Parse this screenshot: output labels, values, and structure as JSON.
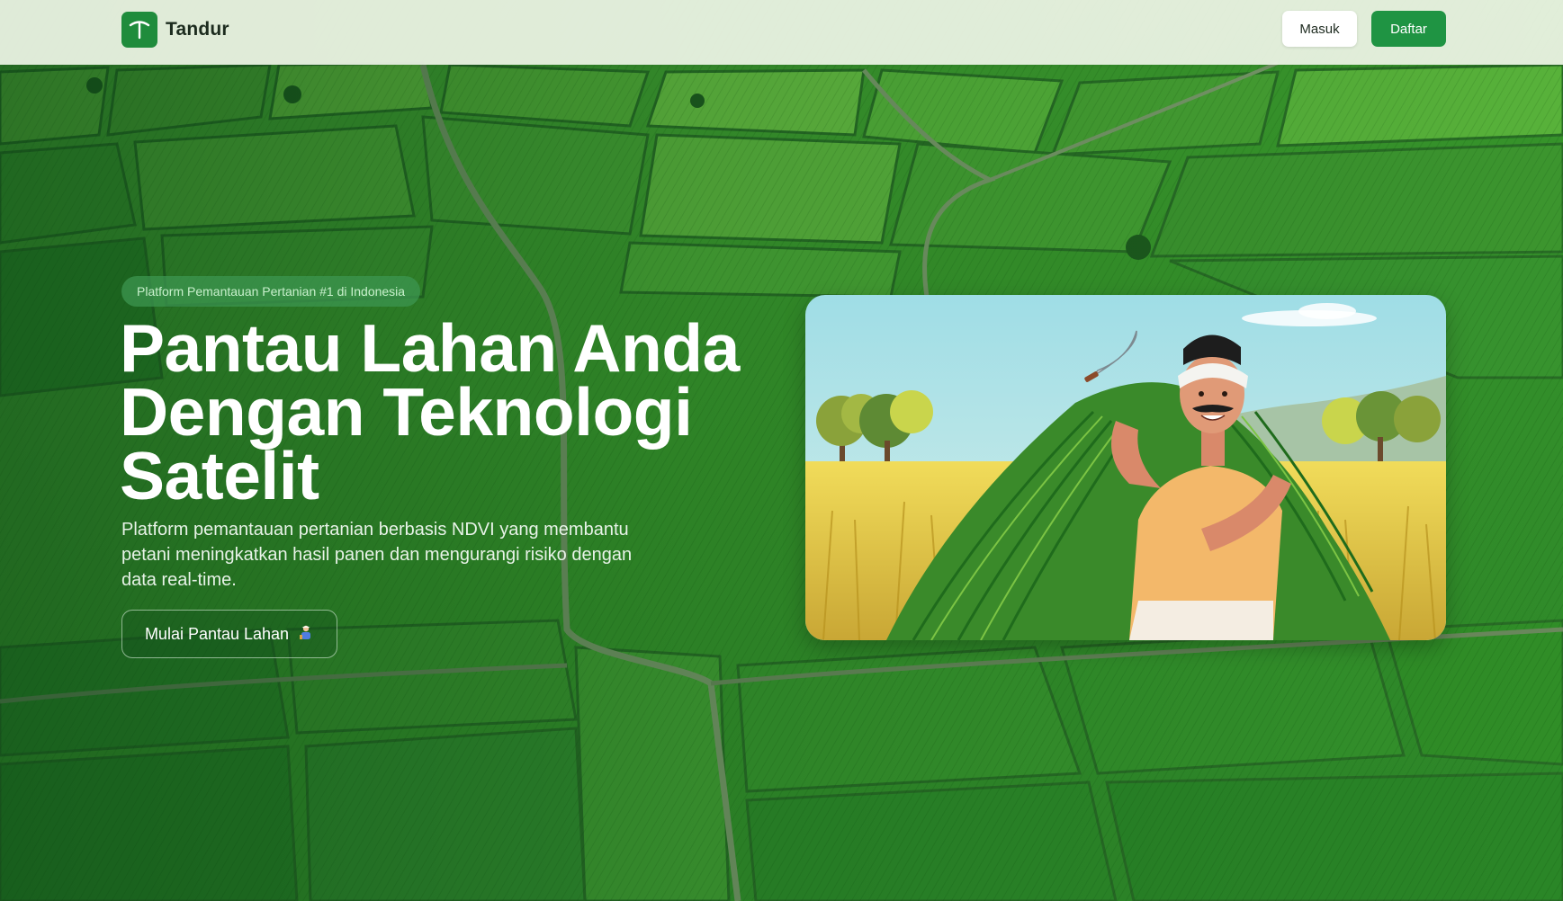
{
  "header": {
    "brand_name": "Tandur",
    "logo_icon": "sprout-icon",
    "login_label": "Masuk",
    "register_label": "Daftar"
  },
  "hero": {
    "badge": "Platform Pemantauan Pertanian #1 di Indonesia",
    "title_lines": [
      "Pantau Lahan Anda",
      "Dengan Teknologi",
      "Satelit"
    ],
    "description": "Platform pemantauan pertanian berbasis NDVI yang membantu petani meningkatkan hasil panen dan mengurangi risiko dengan data real-time.",
    "cta_label": "Mulai Pantau Lahan",
    "cta_icon": "farmer-icon"
  },
  "colors": {
    "brand": "#1f8c3c",
    "primary_button": "#1f9443",
    "field_green": "#3a9a2e",
    "header_bg": "#eef4e6"
  }
}
